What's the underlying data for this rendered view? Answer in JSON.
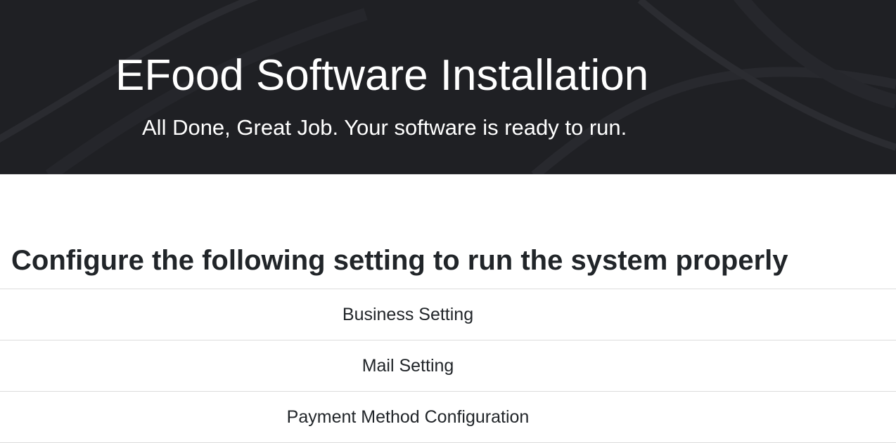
{
  "header": {
    "title": "EFood Software Installation",
    "subtitle": "All Done, Great Job. Your software is ready to run."
  },
  "main": {
    "heading": "Configure the following setting to run the system properly",
    "settings": [
      {
        "label": "Business Setting"
      },
      {
        "label": "Mail Setting"
      },
      {
        "label": "Payment Method Configuration"
      }
    ]
  },
  "colors": {
    "hero_background": "#1f2024",
    "text_dark": "#212529",
    "divider": "#dcdcdc"
  }
}
